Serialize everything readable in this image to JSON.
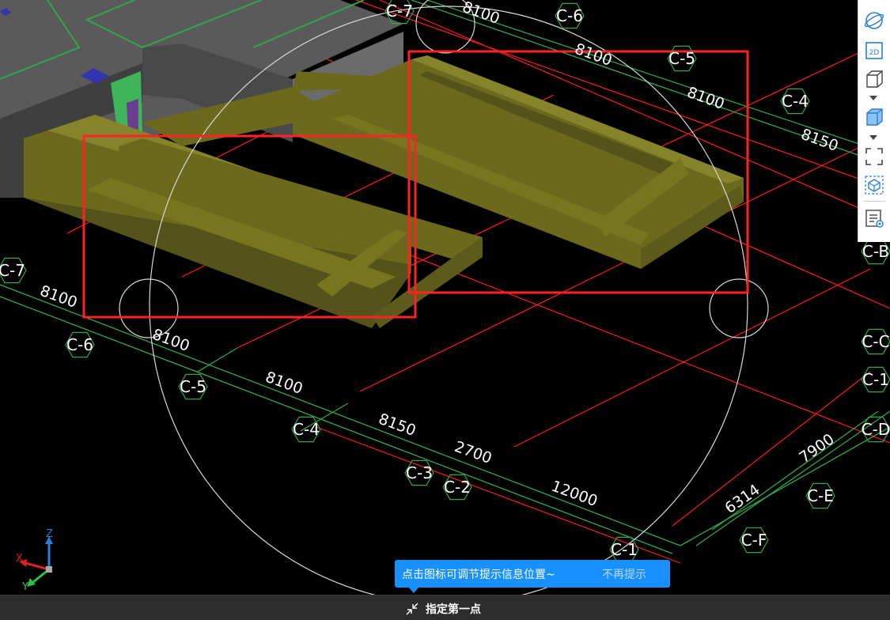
{
  "viewport": {
    "grid_axes": [
      {
        "id": "ax-C7-top",
        "label": "C-7"
      },
      {
        "id": "ax-C6-top",
        "label": "C-6"
      },
      {
        "id": "ax-C5-top",
        "label": "C-5"
      },
      {
        "id": "ax-C4-top",
        "label": "C-4"
      },
      {
        "id": "ax-CB",
        "label": "C-B"
      },
      {
        "id": "ax-CC",
        "label": "C-C"
      },
      {
        "id": "ax-C1-right",
        "label": "C-1"
      },
      {
        "id": "ax-CD",
        "label": "C-D"
      },
      {
        "id": "ax-CE",
        "label": "C-E"
      },
      {
        "id": "ax-CF",
        "label": "C-F"
      },
      {
        "id": "ax-C7-left",
        "label": "C-7"
      },
      {
        "id": "ax-C6",
        "label": "C-6"
      },
      {
        "id": "ax-C5",
        "label": "C-5"
      },
      {
        "id": "ax-C4",
        "label": "C-4"
      },
      {
        "id": "ax-C3",
        "label": "C-3"
      },
      {
        "id": "ax-C2",
        "label": "C-2"
      },
      {
        "id": "ax-C1",
        "label": "C-1"
      }
    ],
    "dimensions": [
      {
        "id": "dim-top-1",
        "text": "8100"
      },
      {
        "id": "dim-top-2",
        "text": "8100"
      },
      {
        "id": "dim-top-3",
        "text": "8100"
      },
      {
        "id": "dim-top-4",
        "text": "8150"
      },
      {
        "id": "dim-bot-1",
        "text": "8100"
      },
      {
        "id": "dim-bot-2",
        "text": "8100"
      },
      {
        "id": "dim-bot-3",
        "text": "8100"
      },
      {
        "id": "dim-bot-4",
        "text": "8150"
      },
      {
        "id": "dim-bot-5",
        "text": "2700"
      },
      {
        "id": "dim-bot-6",
        "text": "12000"
      },
      {
        "id": "dim-right-1",
        "text": "6314"
      },
      {
        "id": "dim-right-2",
        "text": "7900"
      }
    ],
    "colors": {
      "background": "#000000",
      "grid_green": "#2ea84a",
      "grid_red": "#ff1a1a",
      "beam": "#6b6a1c",
      "beam_top": "#86842a",
      "highlight_box": "#ff2222",
      "orbit_circle": "#d8d8d8"
    }
  },
  "toolbar": {
    "items": [
      {
        "name": "orbit-icon"
      },
      {
        "name": "view-2d-icon",
        "text": "2D"
      },
      {
        "name": "view-3d-wire-icon"
      },
      {
        "name": "view-3d-solid-icon"
      },
      {
        "name": "fullscreen-icon"
      },
      {
        "name": "view-cube-icon"
      },
      {
        "name": "properties-icon"
      }
    ]
  },
  "tip": {
    "message": "点击图标可调节提示信息位置~",
    "dismiss": "不再提示",
    "bg": "#1890ff"
  },
  "status": {
    "prompt": "指定第一点"
  },
  "gizmo": {
    "x": "X",
    "y": "Y",
    "z": "Z"
  }
}
